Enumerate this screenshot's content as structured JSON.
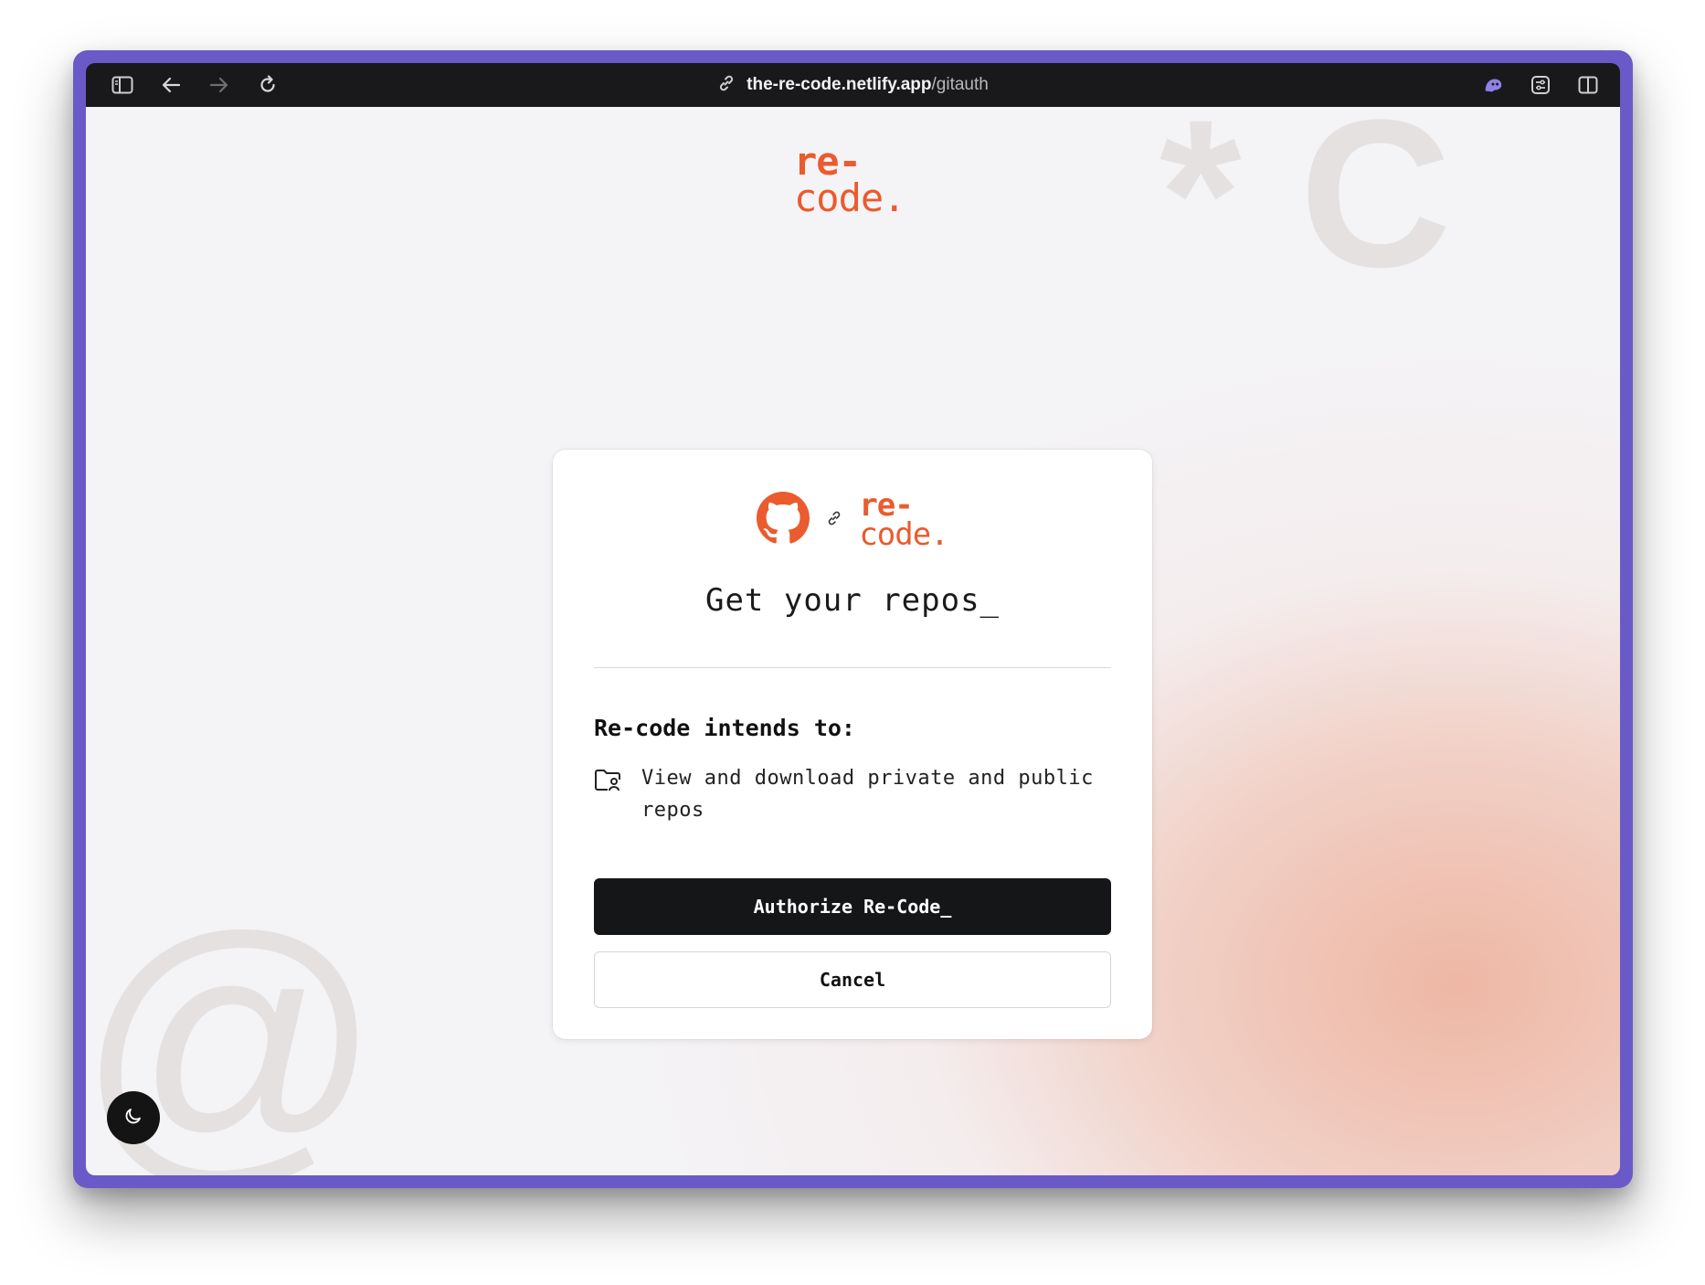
{
  "browser": {
    "url_host": "the-re-code.netlify.app",
    "url_path": "/gitauth",
    "icons": [
      "sidebar-icon",
      "back-arrow-icon",
      "forward-arrow-icon",
      "reload-icon",
      "link-icon",
      "extension-icon",
      "settings-icon",
      "split-view-icon"
    ]
  },
  "background": {
    "glyph_top": "* C",
    "glyph_bottom": "@"
  },
  "header": {
    "brand_line1": "re-",
    "brand_line2": "code."
  },
  "card": {
    "brand_line1": "re-",
    "brand_line2": "code.",
    "title": "Get your repos_",
    "intends_label": "Re-code intends to:",
    "permission_text": "View and download private and public repos",
    "authorize_label": "Authorize Re-Code_",
    "cancel_label": "Cancel"
  },
  "colors": {
    "brand": "#ea5b2e",
    "window_frame": "#6a5ac8",
    "primary_button": "#151618"
  }
}
